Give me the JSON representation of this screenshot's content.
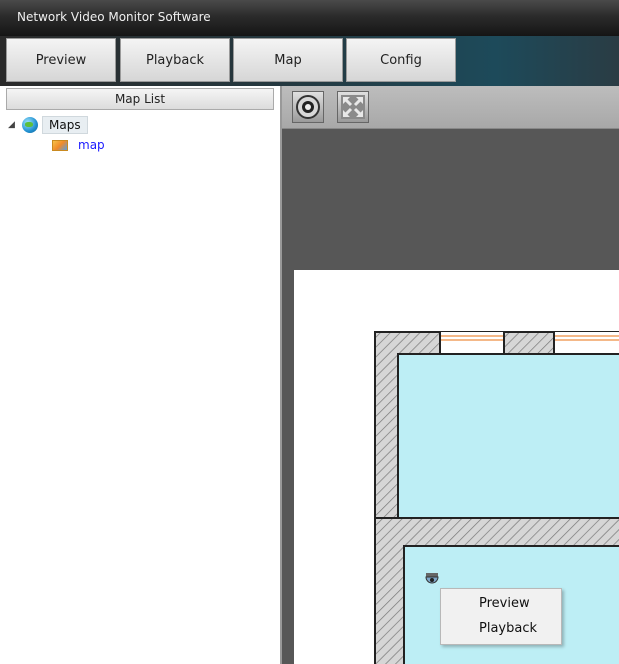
{
  "app": {
    "title": "Network Video Monitor Software"
  },
  "tabs": [
    {
      "label": "Preview"
    },
    {
      "label": "Playback"
    },
    {
      "label": "Map"
    },
    {
      "label": "Config"
    }
  ],
  "sidebar": {
    "header": "Map List",
    "tree": {
      "root_label": "Maps",
      "root_icon": "globe-icon",
      "children": [
        {
          "label": "map",
          "icon": "map-image-icon"
        }
      ]
    }
  },
  "toolbar": {
    "buttons": [
      {
        "icon": "camera-lens-icon"
      },
      {
        "icon": "fullscreen-icon"
      }
    ]
  },
  "context_menu": {
    "items": [
      {
        "label": "Preview"
      },
      {
        "label": "Playback"
      }
    ]
  },
  "colors": {
    "room_fill": "#bdeef5",
    "wall_hatch": "#cfcfcf",
    "window_line": "#f0a060",
    "child_link": "#1a1aff"
  }
}
